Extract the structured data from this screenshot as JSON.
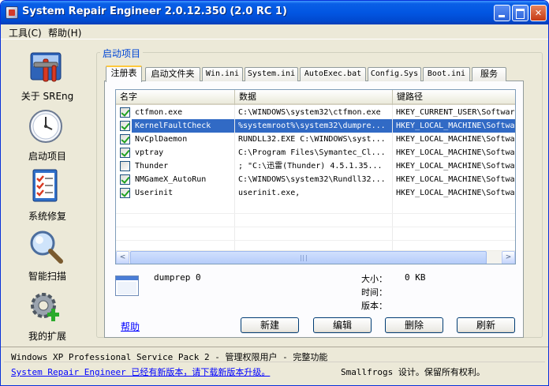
{
  "window": {
    "title": "System Repair Engineer 2.0.12.350 (2.0 RC 1)",
    "minimize": "",
    "maximize": "",
    "close": "✕"
  },
  "menu": [
    {
      "label": "工具(C)"
    },
    {
      "label": "帮助(H)"
    }
  ],
  "sidebar": {
    "items": [
      {
        "label": "关于 SREng",
        "icon": "tools-icon"
      },
      {
        "label": "启动项目",
        "icon": "clock-icon"
      },
      {
        "label": "系统修复",
        "icon": "checklist-icon"
      },
      {
        "label": "智能扫描",
        "icon": "magnifier-icon"
      },
      {
        "label": "我的扩展",
        "icon": "gear-plus-icon"
      }
    ]
  },
  "group_title": "启动项目",
  "tabs": [
    {
      "label": "注册表",
      "active": true
    },
    {
      "label": "启动文件夹"
    },
    {
      "label": "Win.ini"
    },
    {
      "label": "System.ini"
    },
    {
      "label": "AutoExec.bat"
    },
    {
      "label": "Config.Sys"
    },
    {
      "label": "Boot.ini"
    },
    {
      "label": "服务"
    }
  ],
  "table": {
    "columns": [
      "名字",
      "数据",
      "键路径"
    ],
    "rows": [
      {
        "checked": true,
        "name": "ctfmon.exe",
        "data": "C:\\WINDOWS\\system32\\ctfmon.exe",
        "path": "HKEY_CURRENT_USER\\Softwar"
      },
      {
        "checked": true,
        "name": "KernelFaultCheck",
        "data": "%systemroot%\\system32\\dumpre...",
        "path": "HKEY_LOCAL_MACHINE\\Softwa",
        "selected": true
      },
      {
        "checked": true,
        "name": "NvCplDaemon",
        "data": "RUNDLL32.EXE C:\\WINDOWS\\syst...",
        "path": "HKEY_LOCAL_MACHINE\\Softwa"
      },
      {
        "checked": true,
        "name": "vptray",
        "data": "C:\\Program Files\\Symantec_Cl...",
        "path": "HKEY_LOCAL_MACHINE\\Softwa"
      },
      {
        "checked": false,
        "name": "Thunder",
        "data": "; \"C:\\迅雷(Thunder) 4.5.1.35...",
        "path": "HKEY_LOCAL_MACHINE\\Softwa"
      },
      {
        "checked": true,
        "name": "NMGameX_AutoRun",
        "data": "C:\\WINDOWS\\system32\\Rundll32...",
        "path": "HKEY_LOCAL_MACHINE\\Softwa"
      },
      {
        "checked": true,
        "name": "Userinit",
        "data": "userinit.exe,",
        "path": "HKEY_LOCAL_MACHINE\\Softwa"
      }
    ]
  },
  "scrollbar": {
    "left_arrow": "<",
    "right_arrow": ">"
  },
  "details": {
    "name": "dumprep 0",
    "size_label": "大小：",
    "size_value": "0 KB",
    "time_label": "时间：",
    "time_value": "",
    "version_label": "版本：",
    "version_value": ""
  },
  "help_link": "帮助",
  "buttons": {
    "new": "新建",
    "edit": "编辑",
    "delete": "删除",
    "refresh": "刷新"
  },
  "status": {
    "line1": "Windows XP Professional Service Pack 2 - 管理权限用户 - 完整功能",
    "update_link": "System Repair Engineer 已经有新版本，请下载新版本升级。",
    "copyright": "Smallfrogs 设计。保留所有权利。"
  }
}
